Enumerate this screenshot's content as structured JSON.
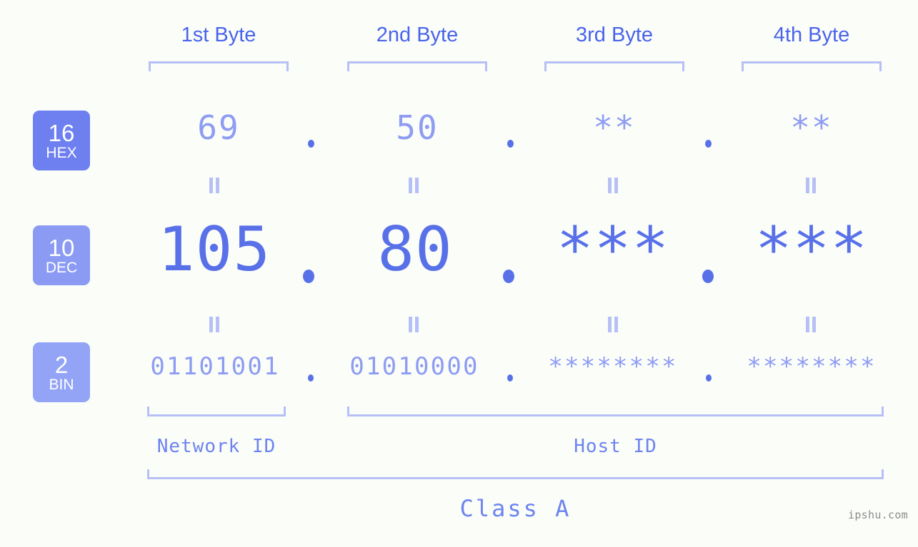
{
  "meta": {
    "background": "#fbfdf9",
    "accent_strong": "#5971e8",
    "accent_mid": "#8e9cf2",
    "accent_light": "#b7c0f6",
    "header_blue": "#4a64ea",
    "watermark": "ipshu.com"
  },
  "headers": [
    {
      "label": "1st Byte"
    },
    {
      "label": "2nd Byte"
    },
    {
      "label": "3rd Byte"
    },
    {
      "label": "4th Byte"
    }
  ],
  "bases": [
    {
      "num": "16",
      "name": "HEX",
      "color": "#6e7ff0"
    },
    {
      "num": "10",
      "name": "DEC",
      "color": "#8b9bf4"
    },
    {
      "num": "2",
      "name": "BIN",
      "color": "#93a4f7"
    }
  ],
  "rows": {
    "hex": {
      "values": [
        "69",
        "50",
        "**",
        "**"
      ],
      "separator": "."
    },
    "dec": {
      "values": [
        "105",
        "80",
        "***",
        "***"
      ],
      "separator": "."
    },
    "bin": {
      "values": [
        "01101001",
        "01010000",
        "********",
        "********"
      ],
      "separator": "."
    }
  },
  "segments": {
    "network_id": "Network ID",
    "host_id": "Host ID",
    "class": "Class A"
  }
}
